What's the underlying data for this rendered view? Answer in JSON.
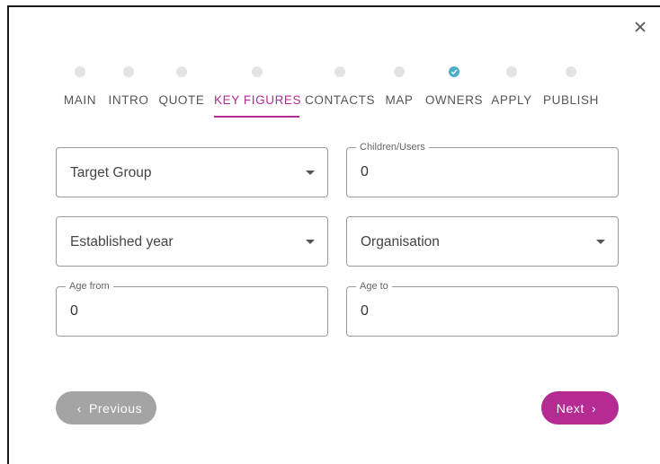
{
  "dialog": {
    "close_icon": "close-icon"
  },
  "steps": [
    {
      "label": "MAIN",
      "status": "pending"
    },
    {
      "label": "INTRO",
      "status": "pending"
    },
    {
      "label": "QUOTE",
      "status": "pending"
    },
    {
      "label": "KEY FIGURES",
      "status": "active"
    },
    {
      "label": "CONTACTS",
      "status": "pending"
    },
    {
      "label": "MAP",
      "status": "pending"
    },
    {
      "label": "OWNERS",
      "status": "done"
    },
    {
      "label": "APPLY",
      "status": "pending"
    },
    {
      "label": "PUBLISH",
      "status": "pending"
    }
  ],
  "form": {
    "target_group": {
      "placeholder": "Target Group"
    },
    "children_users": {
      "label": "Children/Users",
      "value": "0"
    },
    "established_year": {
      "placeholder": "Established year"
    },
    "organisation": {
      "placeholder": "Organisation"
    },
    "age_from": {
      "label": "Age from",
      "value": "0"
    },
    "age_to": {
      "label": "Age to",
      "value": "0"
    }
  },
  "nav": {
    "previous_label": "Previous",
    "next_label": "Next"
  },
  "colors": {
    "accent": "#b42c92",
    "done": "#4aaec8",
    "previous_button": "#a4a4a4"
  }
}
